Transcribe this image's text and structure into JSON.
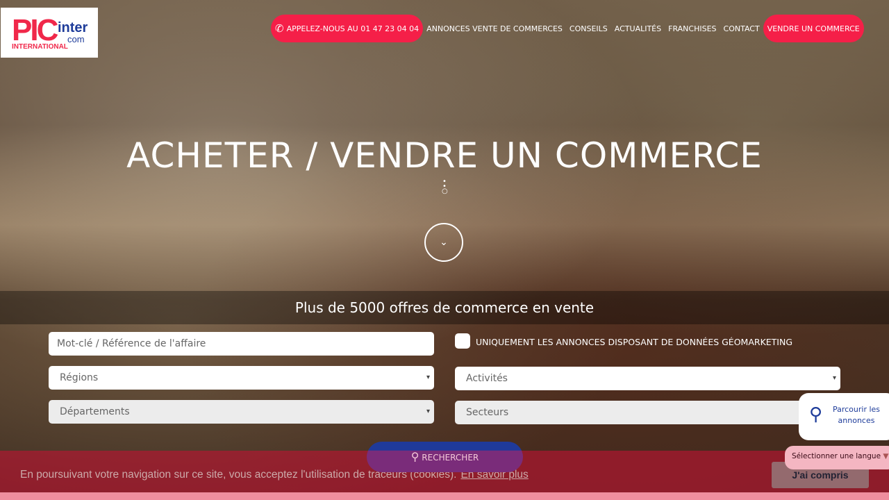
{
  "logo": {
    "pic": "PIC",
    "inter": "inter",
    "com": "com",
    "intl": "INTERNATIONAL"
  },
  "nav": {
    "phone": "APPELEZ-NOUS AU 01 47 23 04 04",
    "items": [
      "ANNONCES VENTE DE COMMERCES",
      "CONSEILS",
      "ACTUALITÉS",
      "FRANCHISES",
      "CONTACT"
    ],
    "sell": "VENDRE UN COMMERCE"
  },
  "hero": {
    "title": "ACHETER / VENDRE UN COMMERCE"
  },
  "search": {
    "heading": "Plus de 5000 offres de commerce en vente",
    "keyword_placeholder": "Mot-clé / Référence de l'affaire",
    "geomarketing_label": "UNIQUEMENT LES ANNONCES DISPOSANT DE DONNÉES GÉOMARKETING",
    "regions": "Régions",
    "activites": "Activités",
    "departements": "Départements",
    "secteurs": "Secteurs",
    "button": "RECHERCHER"
  },
  "widgets": {
    "browse": "Parcourir les annonces",
    "language": "Sélectionner une langue"
  },
  "cookie": {
    "text": "En poursuivant votre navigation sur ce site, vous acceptez l'utilisation de traceurs (cookies).",
    "link": "En savoir plus",
    "accept": "J'ai compris"
  },
  "colors": {
    "accent": "#f51f48",
    "blue": "#1f3a9a"
  }
}
